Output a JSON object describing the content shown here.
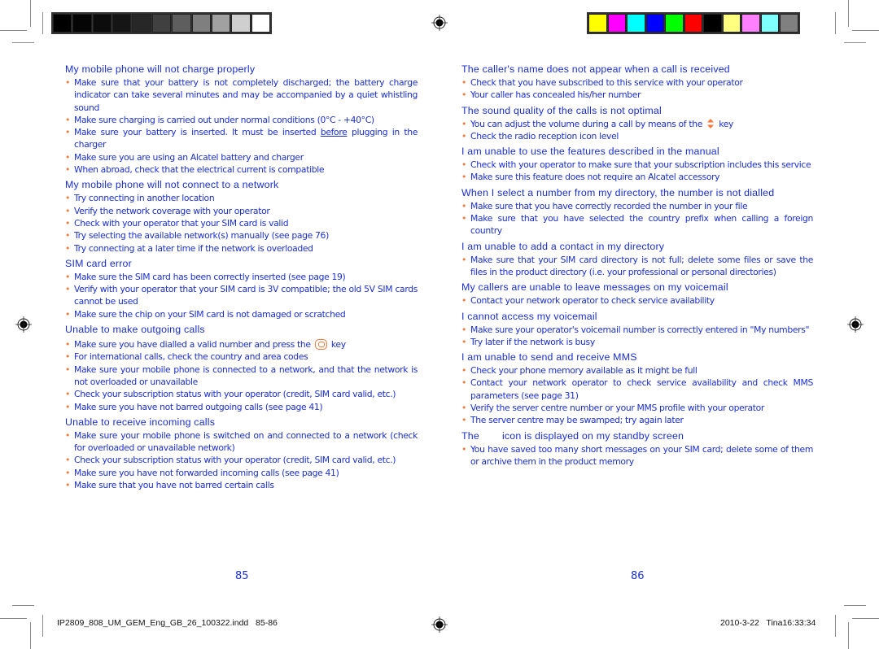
{
  "print_marks": {
    "gray_bar_colors": [
      "#000000",
      "#050505",
      "#0c0c0c",
      "#151515",
      "#272727",
      "#404040",
      "#5e5e5e",
      "#7f7f7f",
      "#a1a1a1",
      "#cfcfcf",
      "#ffffff"
    ],
    "color_bar_colors": [
      "#ffff00",
      "#ff00ff",
      "#00ffff",
      "#0000ff",
      "#00ff00",
      "#ff0000",
      "#000000",
      "#ffff80",
      "#ff80ff",
      "#80ffff",
      "#808080"
    ]
  },
  "left_page": {
    "page_number": "85",
    "sections": [
      {
        "heading": "My mobile phone will not charge properly",
        "items": [
          "Make sure that your battery is not completely discharged; the battery charge indicator can take several minutes and may be accompanied by a quiet whistling sound",
          "Make sure charging is carried out under normal conditions (0°C - +40°C)",
          {
            "before": "Make sure your battery is inserted. It must be inserted ",
            "underlined": "before",
            "after": " plugging in the charger"
          },
          "Make sure you are using an Alcatel battery and charger",
          "When abroad, check that the electrical current is compatible"
        ]
      },
      {
        "heading": "My mobile phone will not connect to a network",
        "items": [
          "Try connecting in another location",
          "Verify the network coverage with your operator",
          "Check with your operator that your SIM card is valid",
          "Try selecting the available network(s) manually (see page 76)",
          "Try connecting at a later time if the network is overloaded"
        ]
      },
      {
        "heading": "SIM card error",
        "items": [
          "Make sure the SIM card has been correctly inserted (see page 19)",
          "Verify with your operator that your SIM card is 3V compatible; the old 5V SIM cards cannot be used",
          "Make sure the chip on your SIM card is not damaged or scratched"
        ]
      },
      {
        "heading": "Unable to make outgoing calls",
        "items": [
          {
            "before": "Make sure you have dialled a valid number and press the",
            "icon": "call-key-icon",
            "after": "key"
          },
          "For international calls, check the country and area codes",
          "Make sure your mobile phone is connected to a network, and that the network is not overloaded or unavailable",
          "Check your subscription status with your operator (credit, SIM card valid, etc.)",
          "Make sure you have not barred outgoing calls (see page 41)"
        ]
      },
      {
        "heading": "Unable to receive incoming calls",
        "items": [
          "Make sure your mobile phone is switched on and connected to a network (check for overloaded or unavailable network)",
          "Check your subscription status with your operator (credit, SIM card valid, etc.)",
          "Make sure you have not forwarded incoming calls (see page 41)",
          "Make sure that you have not barred certain calls"
        ]
      }
    ]
  },
  "right_page": {
    "page_number": "86",
    "sections": [
      {
        "heading": "The caller's name does not appear when a call is received",
        "items": [
          "Check that you have subscribed to this service with your operator",
          "Your caller has concealed his/her number"
        ]
      },
      {
        "heading": "The sound quality of the calls is not optimal",
        "items": [
          {
            "before": "You can adjust the volume during a call by means of the",
            "icon": "volume-key-icon",
            "after": "key"
          },
          "Check the radio reception icon level"
        ]
      },
      {
        "heading": "I am unable to use the features described in the manual",
        "items": [
          "Check with your operator to make sure that your subscription includes this service",
          "Make sure this feature does not require an Alcatel accessory"
        ]
      },
      {
        "heading": "When I select a number from my directory, the number is not dialled",
        "items": [
          "Make sure that you have correctly recorded the number in your file",
          "Make sure that you have selected the country prefix when calling a foreign country"
        ]
      },
      {
        "heading": "I am unable to add a contact in my directory",
        "items": [
          "Make sure that your SIM card directory is not full; delete some files or save the files in the product directory (i.e. your professional or personal directories)"
        ]
      },
      {
        "heading": "My callers are unable to leave messages on my voicemail",
        "items": [
          "Contact your network operator to check service availability"
        ]
      },
      {
        "heading": "I cannot access my voicemail",
        "items": [
          "Make sure your operator's voicemail number is correctly entered in \"My numbers\"",
          "Try later if the network is busy"
        ]
      },
      {
        "heading": "I am unable to send and receive MMS",
        "items": [
          "Check your phone memory available as it might be full",
          "Contact your network operator to check service availability and check MMS parameters (see page 31)",
          "Verify the server centre number or your MMS profile with your operator",
          "The server centre may be swamped; try again later"
        ]
      },
      {
        "heading_before": "The",
        "heading_after": "icon is displayed on my standby screen",
        "items": [
          "You have saved too many short messages on your SIM card; delete some of them or archive them in the product memory"
        ]
      }
    ]
  },
  "slug": {
    "file_name": "IP2809_808_UM_GEM_Eng_GB_26_100322.indd   85-86",
    "timestamp": "2010-3-22   Tina16:33:34"
  }
}
